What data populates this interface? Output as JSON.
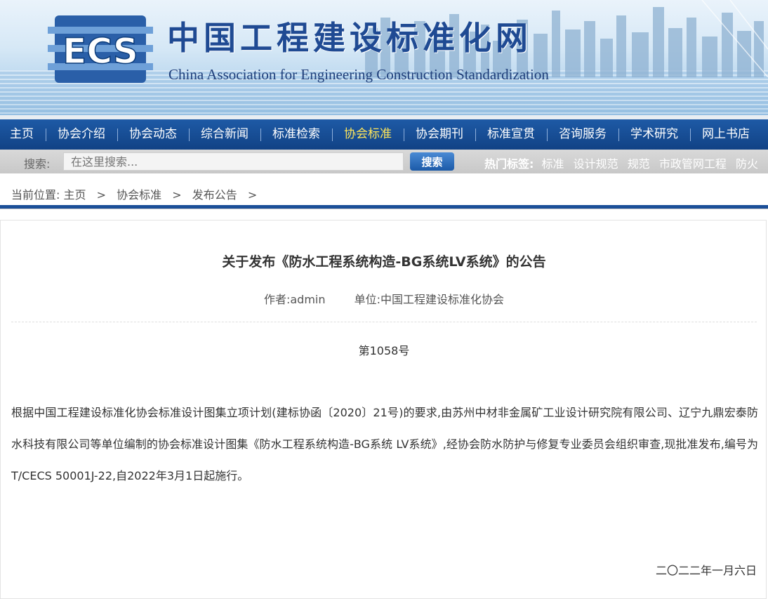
{
  "header": {
    "logo_text": "ECS",
    "title": "中国工程建设标准化网",
    "subtitle": "China Association for Engineering Construction Standardization"
  },
  "nav": {
    "items": [
      {
        "label": "主页",
        "active": false
      },
      {
        "label": "协会介绍",
        "active": false
      },
      {
        "label": "协会动态",
        "active": false
      },
      {
        "label": "综合新闻",
        "active": false
      },
      {
        "label": "标准检索",
        "active": false
      },
      {
        "label": "协会标准",
        "active": true
      },
      {
        "label": "协会期刊",
        "active": false
      },
      {
        "label": "标准宣贯",
        "active": false
      },
      {
        "label": "咨询服务",
        "active": false
      },
      {
        "label": "学术研究",
        "active": false
      },
      {
        "label": "网上书店",
        "active": false
      }
    ]
  },
  "search": {
    "label": "搜索:",
    "placeholder": "在这里搜索...",
    "button": "搜索",
    "hot_label": "热门标签:",
    "hot_tags": [
      "标准",
      "设计规范",
      "规范",
      "市政管网工程",
      "防火"
    ]
  },
  "breadcrumb": {
    "prefix": "当前位置:",
    "items": [
      "主页",
      "协会标准",
      "发布公告"
    ],
    "separator": ">"
  },
  "article": {
    "title": "关于发布《防水工程系统构造-BG系统LV系统》的公告",
    "author": "作者:admin",
    "unit": "单位:中国工程建设标准化协会",
    "number": "第1058号",
    "body": "根据中国工程建设标准化协会标准设计图集立项计划(建标协函〔2020〕21号)的要求,由苏州中材非金属矿工业设计研究院有限公司、辽宁九鼎宏泰防水科技有限公司等单位编制的协会标准设计图集《防水工程系统构造-BG系统 LV系统》,经协会防水防护与修复专业委员会组织审查,现批准发布,编号为T/CECS 50001J-22,自2022年3月1日起施行。",
    "date": "二〇二二年一月六日"
  },
  "colors": {
    "nav_bg": "#1b4f98",
    "nav_active": "#ffe65a",
    "title_blue": "#1f4a93"
  }
}
